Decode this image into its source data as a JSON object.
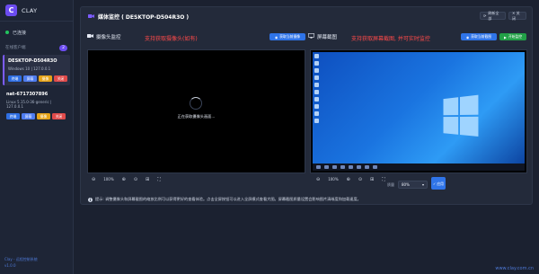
{
  "app": {
    "logo_letter": "C",
    "name": "CLAY"
  },
  "sidebar": {
    "status_label": "已连接",
    "section_title": "在线客户端",
    "client_count": "2",
    "clients": [
      {
        "name": "DESKTOP-D504R3O",
        "info": "Windows 10 | 127.0.0.1",
        "actions": [
          "终端",
          "屏幕",
          "摄像",
          "关闭"
        ]
      },
      {
        "name": "nat-6717307896",
        "info": "Linux 5.15.0-36-generic | 127.0.0.1",
        "actions": [
          "终端",
          "屏幕",
          "摄像",
          "关闭"
        ]
      }
    ],
    "footer_line1": "Clay - 远程控制系统",
    "footer_line2": "v1.0.0"
  },
  "main": {
    "header": {
      "title": "媒体监控 ( DESKTOP-D504R3O )",
      "refresh_label": "刷新全部",
      "close_label": "✕ 关闭"
    },
    "camera": {
      "title": "摄像头监控",
      "note": "支持获取摄像头(如有)",
      "capture_label": "获取当前摄像",
      "loading_text": "正在获取摄像头画面...",
      "zoom": "100%"
    },
    "screen": {
      "title": "屏幕截图",
      "note": "支持获取屏幕截图, 并可实时监控",
      "capture_label": "获取当前截图",
      "live_label": "开始监控",
      "zoom": "100%",
      "quality_label": "质量",
      "quality_value": "80%",
      "apply_label": "✓ 应用"
    },
    "hint": "提示: 调整摄像头和屏幕截图的缩放比例可以获得更好的查看体验。点击全屏按钮可以进入全屏模式查看大图。屏幕截图质量设置会影响图片清晰度和加载速度。"
  },
  "watermark": "www.clay.com.cn",
  "colors": {
    "accent": "#6c4cf0",
    "online": "#22c55e",
    "note_red": "#ff4a4a",
    "primary_blue": "#2f74e8"
  }
}
